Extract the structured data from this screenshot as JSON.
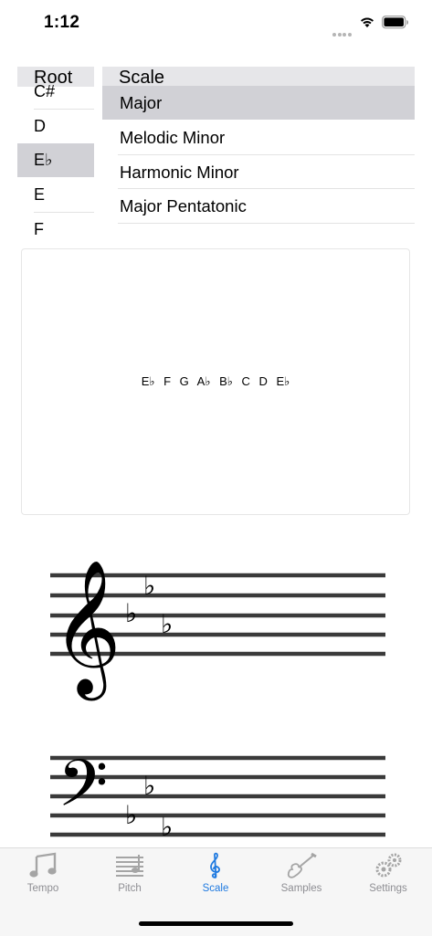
{
  "status_bar": {
    "time": "1:12"
  },
  "root_picker": {
    "header": "Root",
    "items": [
      "C#",
      "D",
      "E♭",
      "E",
      "F"
    ],
    "selected": "E♭"
  },
  "scale_picker": {
    "header": "Scale",
    "items": [
      "Major",
      "Melodic Minor",
      "Harmonic Minor",
      "Major Pentatonic"
    ],
    "selected": "Major"
  },
  "scale_notes": "E♭ F G A♭ B♭ C D E♭",
  "notation": {
    "treble_clef": "𝄞",
    "bass_clef": "𝄢",
    "flat_glyph": "♭"
  },
  "tab_bar": {
    "tabs": [
      {
        "label": "Tempo",
        "icon": "music-note-icon"
      },
      {
        "label": "Pitch",
        "icon": "staff-icon"
      },
      {
        "label": "Scale",
        "icon": "treble-clef-icon"
      },
      {
        "label": "Samples",
        "icon": "guitar-icon"
      },
      {
        "label": "Settings",
        "icon": "gears-icon"
      }
    ],
    "selected": "Scale"
  },
  "colors": {
    "accent": "#1f7ae0",
    "selected_row": "#d1d1d6",
    "header_bg": "#e6e6e9",
    "inactive_tab": "#8e8e93"
  }
}
